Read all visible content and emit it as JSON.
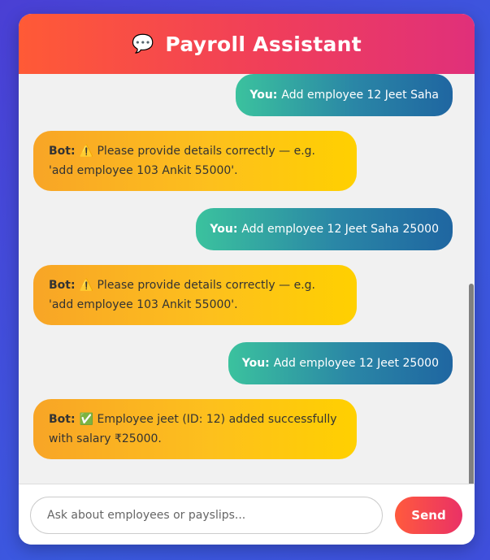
{
  "header": {
    "icon": "💬",
    "title": "Payroll Assistant"
  },
  "messages": [
    {
      "sender": "You:",
      "text": "Add employee 12 Jeet Saha"
    },
    {
      "sender": "Bot:",
      "icon": "⚠️",
      "text": "Please provide details correctly — e.g. 'add employee 103 Ankit 55000'."
    },
    {
      "sender": "You:",
      "text": "Add employee 12 Jeet Saha 25000"
    },
    {
      "sender": "Bot:",
      "icon": "⚠️",
      "text": "Please provide details correctly — e.g. 'add employee 103 Ankit 55000'."
    },
    {
      "sender": "You:",
      "text": "Add employee 12 Jeet 25000"
    },
    {
      "sender": "Bot:",
      "icon": "✅",
      "text": "Employee jeet (ID: 12) added successfully with salary ₹25000."
    }
  ],
  "input": {
    "placeholder": "Ask about employees or payslips..."
  },
  "send_label": "Send"
}
